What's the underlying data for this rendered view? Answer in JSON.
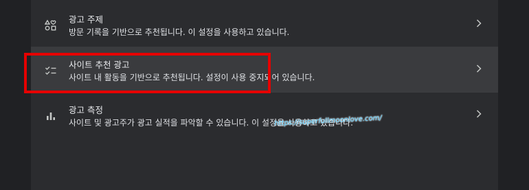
{
  "settings": {
    "items": [
      {
        "icon": "ad-topics-icon",
        "title": "광고 주제",
        "description": "방문 기록을 기반으로 추천됩니다. 이 설정을 사용하고 있습니다."
      },
      {
        "icon": "site-suggested-ads-icon",
        "title": "사이트 추천 광고",
        "description": "사이트 내 활동을 기반으로 추천됩니다. 설정이 사용 중지되어 있습니다."
      },
      {
        "icon": "ad-measurement-icon",
        "title": "광고 측정",
        "description": "사이트 및 광고주가 광고 실적을 파악할 수 있습니다. 이 설정을 사용하고 있습니다."
      }
    ]
  },
  "watermark": {
    "text": "https://superfullmoonlove.com/"
  },
  "colors": {
    "background": "#202124",
    "panel": "#2b2c2f",
    "hover_row": "#3a3b3e",
    "highlight": "#e60000",
    "watermark": "#5fd0ff"
  }
}
